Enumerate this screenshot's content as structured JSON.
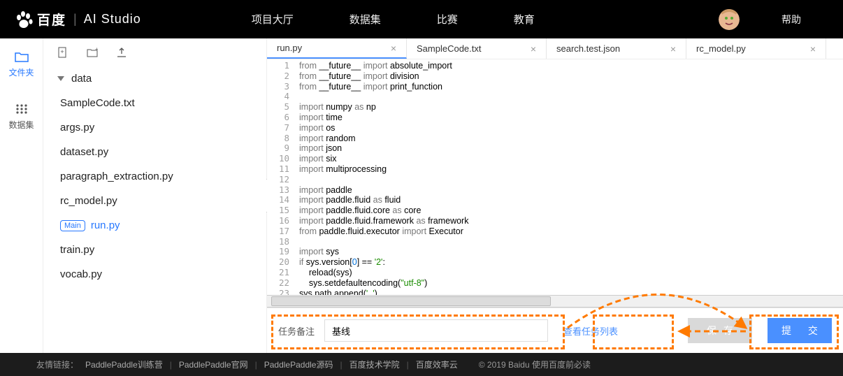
{
  "header": {
    "brand": "百度",
    "studio": "AI Studio",
    "nav": [
      "项目大厅",
      "数据集",
      "比赛",
      "教育"
    ],
    "help": "帮助"
  },
  "rail": {
    "files": "文件夹",
    "datasets": "数据集"
  },
  "toolbar": {
    "new": "new-file",
    "newdir": "new-folder",
    "upload": "upload"
  },
  "tree": {
    "dir": "data",
    "files": [
      "SampleCode.txt",
      "args.py",
      "dataset.py",
      "paragraph_extraction.py",
      "rc_model.py"
    ],
    "mainTag": "Main",
    "mainFile": "run.py",
    "rest": [
      "train.py",
      "vocab.py"
    ]
  },
  "tabs": [
    {
      "label": "run.py",
      "active": true
    },
    {
      "label": "SampleCode.txt",
      "active": false
    },
    {
      "label": "search.test.json",
      "active": false
    },
    {
      "label": "rc_model.py",
      "active": false
    }
  ],
  "code": {
    "lines": [
      [
        [
          "kw",
          "from "
        ],
        [
          "nm",
          "__future__ "
        ],
        [
          "kw",
          "import "
        ],
        [
          "nm",
          "absolute_import"
        ]
      ],
      [
        [
          "kw",
          "from "
        ],
        [
          "nm",
          "__future__ "
        ],
        [
          "kw",
          "import "
        ],
        [
          "nm",
          "division"
        ]
      ],
      [
        [
          "kw",
          "from "
        ],
        [
          "nm",
          "__future__ "
        ],
        [
          "kw",
          "import "
        ],
        [
          "nm",
          "print_function"
        ]
      ],
      [],
      [
        [
          "kw",
          "import "
        ],
        [
          "nm",
          "numpy "
        ],
        [
          "kw",
          "as "
        ],
        [
          "nm",
          "np"
        ]
      ],
      [
        [
          "kw",
          "import "
        ],
        [
          "nm",
          "time"
        ]
      ],
      [
        [
          "kw",
          "import "
        ],
        [
          "nm",
          "os"
        ]
      ],
      [
        [
          "kw",
          "import "
        ],
        [
          "nm",
          "random"
        ]
      ],
      [
        [
          "kw",
          "import "
        ],
        [
          "nm",
          "json"
        ]
      ],
      [
        [
          "kw",
          "import "
        ],
        [
          "nm",
          "six"
        ]
      ],
      [
        [
          "kw",
          "import "
        ],
        [
          "nm",
          "multiprocessing"
        ]
      ],
      [],
      [
        [
          "kw",
          "import "
        ],
        [
          "nm",
          "paddle"
        ]
      ],
      [
        [
          "kw",
          "import "
        ],
        [
          "nm",
          "paddle.fluid "
        ],
        [
          "kw",
          "as "
        ],
        [
          "nm",
          "fluid"
        ]
      ],
      [
        [
          "kw",
          "import "
        ],
        [
          "nm",
          "paddle.fluid.core "
        ],
        [
          "kw",
          "as "
        ],
        [
          "nm",
          "core"
        ]
      ],
      [
        [
          "kw",
          "import "
        ],
        [
          "nm",
          "paddle.fluid.framework "
        ],
        [
          "kw",
          "as "
        ],
        [
          "nm",
          "framework"
        ]
      ],
      [
        [
          "kw",
          "from "
        ],
        [
          "nm",
          "paddle.fluid.executor "
        ],
        [
          "kw",
          "import "
        ],
        [
          "nm",
          "Executor"
        ]
      ],
      [],
      [
        [
          "kw",
          "import "
        ],
        [
          "nm",
          "sys"
        ]
      ],
      [
        [
          "kw",
          "if "
        ],
        [
          "nm",
          "sys.version["
        ],
        [
          "num",
          "0"
        ],
        [
          "nm",
          "] == "
        ],
        [
          "str",
          "'2'"
        ],
        [
          "nm",
          ":"
        ]
      ],
      [
        [
          "nm",
          "    reload(sys)"
        ]
      ],
      [
        [
          "nm",
          "    sys.setdefaultencoding("
        ],
        [
          "str",
          "\"utf-8\""
        ],
        [
          "nm",
          ")"
        ]
      ],
      [
        [
          "nm",
          "sys.path.append("
        ],
        [
          "str",
          "'..'"
        ],
        [
          "nm",
          ")"
        ]
      ],
      []
    ]
  },
  "action": {
    "remarkLabel": "任务备注",
    "remarkValue": "基线",
    "viewTasks": "查看任务列表",
    "save": "保存",
    "submit": "提 交"
  },
  "footer": {
    "label": "友情链接：",
    "links": [
      "PaddlePaddle训练营",
      "PaddlePaddle官网",
      "PaddlePaddle源码",
      "百度技术学院",
      "百度效率云"
    ],
    "copyright": "© 2019 Baidu 使用百度前必读"
  }
}
